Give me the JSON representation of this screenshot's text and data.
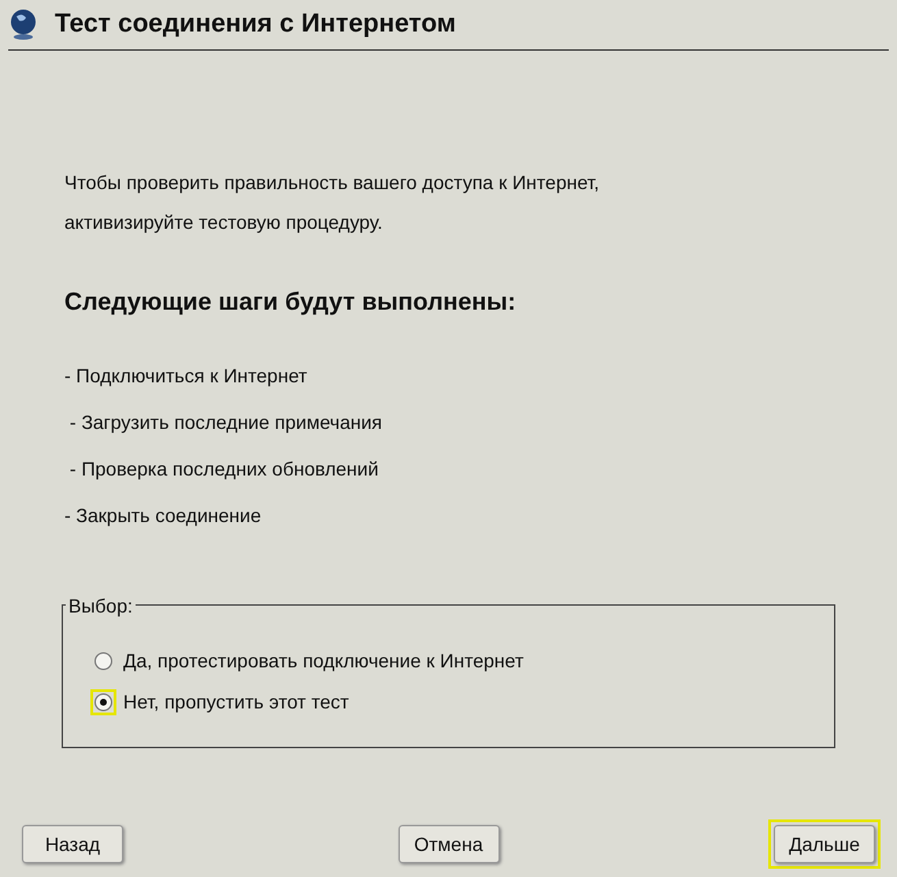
{
  "window": {
    "title": "Тест соединения с Интернетом"
  },
  "intro": [
    "Чтобы проверить правильность вашего доступа к Интернет,",
    "активизируйте тестовую процедуру."
  ],
  "heading": "Следующие шаги будут выполнены:",
  "steps": [
    "- Подключиться к Интернет",
    " - Загрузить последние примечания",
    " - Проверка последних обновлений",
    "- Закрыть соединение"
  ],
  "choice": {
    "legend": "Выбор:",
    "options": [
      {
        "label": "Да, протестировать подключение к Интернет",
        "selected": false
      },
      {
        "label": "Нет, пропустить этот тест",
        "selected": true
      }
    ]
  },
  "buttons": [
    {
      "label": "Назад",
      "focused": false
    },
    {
      "label": "Отмена",
      "focused": false
    },
    {
      "label": "Дальше",
      "focused": true
    }
  ]
}
